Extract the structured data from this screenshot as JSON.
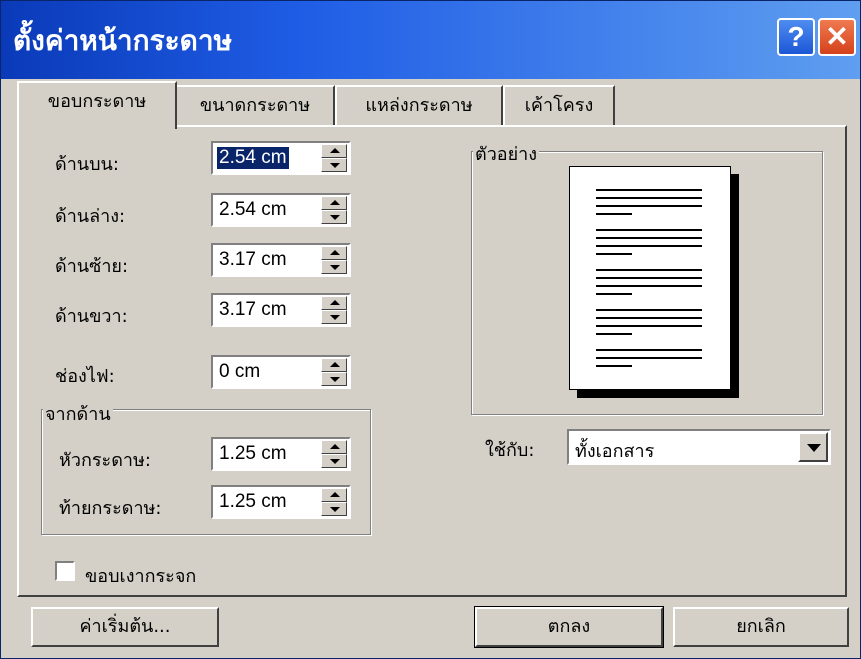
{
  "window": {
    "title": "ตั้งค่าหน้ากระดาษ",
    "help_glyph": "?",
    "close_glyph": "✕"
  },
  "tabs": [
    {
      "label": "ขอบกระดาษ",
      "active": true
    },
    {
      "label": "ขนาดกระดาษ",
      "active": false
    },
    {
      "label": "แหล่งกระดาษ",
      "active": false
    },
    {
      "label": "เค้าโครง",
      "active": false
    }
  ],
  "margins": {
    "top_label": "ด้านบน:",
    "top_value": "2.54 cm",
    "bottom_label": "ด้านล่าง:",
    "bottom_value": "2.54 cm",
    "left_label": "ด้านซ้าย:",
    "left_value": "3.17 cm",
    "right_label": "ด้านขวา:",
    "right_value": "3.17 cm",
    "gutter_label": "ช่องไฟ:",
    "gutter_value": "0 cm"
  },
  "from_edge": {
    "title": "จากด้าน",
    "header_label": "หัวกระดาษ:",
    "header_value": "1.25 cm",
    "footer_label": "ท้ายกระดาษ:",
    "footer_value": "1.25 cm"
  },
  "preview": {
    "title": "ตัวอย่าง"
  },
  "apply_to": {
    "label": "ใช้กับ:",
    "value": "ทั้งเอกสาร"
  },
  "mirror_margins": {
    "label": "ขอบเงากระจก",
    "checked": false
  },
  "buttons": {
    "default": "ค่าเริ่มต้น...",
    "ok": "ตกลง",
    "cancel": "ยกเลิก"
  },
  "colors": {
    "titlebar_start": "#0a3ab8",
    "titlebar_end": "#5f9ef0",
    "face": "#d4d0c8",
    "selection": "#0a246a"
  }
}
